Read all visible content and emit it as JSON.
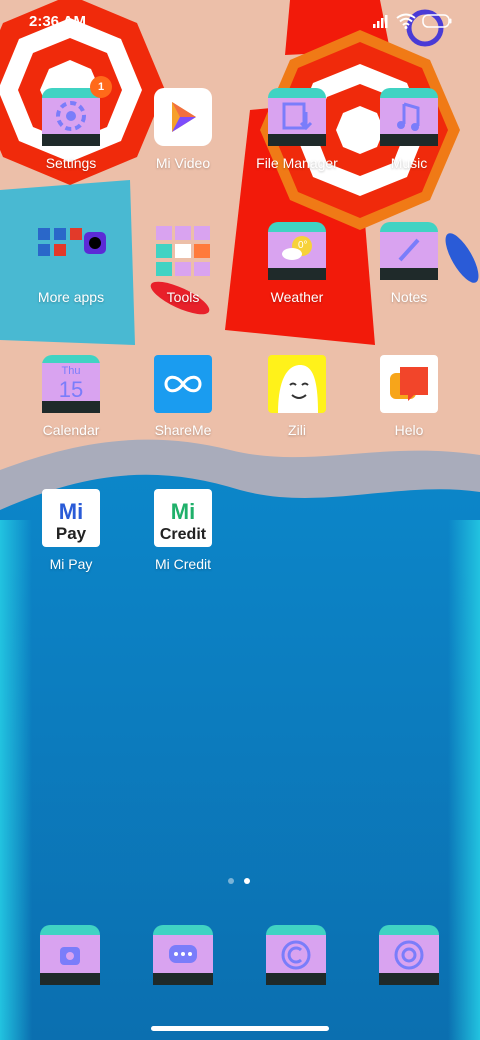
{
  "status_bar": {
    "time": "2:36 AM",
    "icons": [
      "signal-icon",
      "wifi-icon",
      "battery-icon"
    ]
  },
  "rows": [
    [
      {
        "label": "Settings",
        "icon": "settings-icon",
        "badge": "1"
      },
      {
        "label": "Mi Video",
        "icon": "mi-video-icon"
      },
      {
        "label": "File Manager",
        "icon": "file-manager-icon"
      },
      {
        "label": "Music",
        "icon": "music-icon"
      }
    ],
    [
      {
        "label": "More apps",
        "icon": "more-apps-folder-icon"
      },
      {
        "label": "Tools",
        "icon": "tools-folder-icon"
      },
      {
        "label": "Weather",
        "icon": "weather-icon",
        "temp": "0°"
      },
      {
        "label": "Notes",
        "icon": "notes-icon"
      }
    ],
    [
      {
        "label": "Calendar",
        "icon": "calendar-icon",
        "day": "Thu",
        "date": "15"
      },
      {
        "label": "ShareMe",
        "icon": "shareme-icon"
      },
      {
        "label": "Zili",
        "icon": "zili-icon"
      },
      {
        "label": "Helo",
        "icon": "helo-icon"
      }
    ],
    [
      {
        "label": "Mi Pay",
        "icon": "mi-pay-icon",
        "line1": "Mi",
        "line2": "Pay"
      },
      {
        "label": "Mi Credit",
        "icon": "mi-credit-icon",
        "line1": "Mi",
        "line2": "Credit"
      }
    ]
  ],
  "pages": {
    "count": 2,
    "active": 2
  },
  "dock": [
    {
      "icon": "phone-icon"
    },
    {
      "icon": "messages-icon"
    },
    {
      "icon": "browser-icon"
    },
    {
      "icon": "camera-icon"
    }
  ],
  "colors": {
    "sand": "#ecbfa9",
    "sea": "#0b82c4",
    "umbrella_red": "#f02a0b",
    "badge": "#ff6a1a"
  }
}
